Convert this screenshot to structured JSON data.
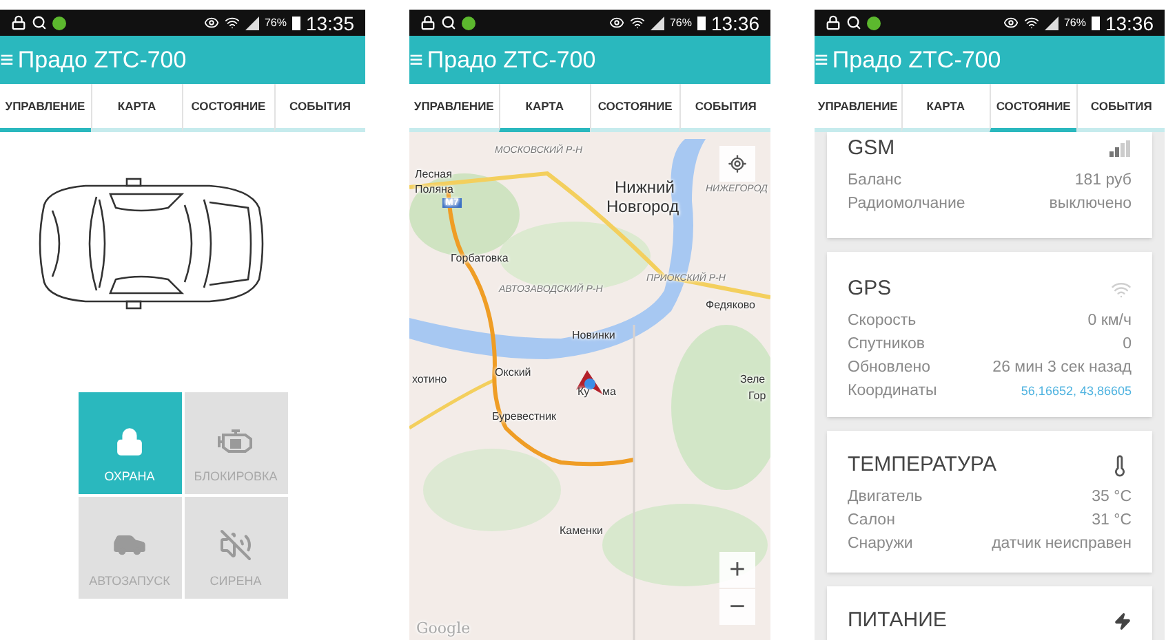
{
  "screens": [
    {
      "status_bar": {
        "battery": "76%",
        "time": "13:35"
      },
      "app_bar": {
        "menu": "≡",
        "title": "Прадо ZTC-700"
      },
      "tabs": [
        {
          "label": "УПРАВЛЕНИЕ",
          "selected": true
        },
        {
          "label": "КАРТА",
          "selected": false
        },
        {
          "label": "СОСТОЯНИЕ",
          "selected": false
        },
        {
          "label": "СОБЫТИЯ",
          "selected": false
        }
      ],
      "content": {
        "kind": "control",
        "tiles": [
          {
            "kind": "lock",
            "label": "ОХРАНА",
            "active": true
          },
          {
            "kind": "engine",
            "label": "БЛОКИРОВКА",
            "active": false
          },
          {
            "kind": "car",
            "label": "АВТОЗАПУСК",
            "active": false
          },
          {
            "kind": "siren",
            "label": "СИРЕНА",
            "active": false
          }
        ]
      }
    },
    {
      "status_bar": {
        "battery": "76%",
        "time": "13:36"
      },
      "app_bar": {
        "menu": "≡",
        "title": "Прадо ZTC-700"
      },
      "tabs": [
        {
          "label": "УПРАВЛЕНИЕ",
          "selected": false
        },
        {
          "label": "КАРТА",
          "selected": true
        },
        {
          "label": "СОСТОЯНИЕ",
          "selected": false
        },
        {
          "label": "СОБЫТИЯ",
          "selected": false
        }
      ],
      "content": {
        "kind": "map",
        "zoom_in": "+",
        "zoom_out": "−",
        "labels": [
          {
            "kind": "district",
            "text": "МОСКОВСКИЙ Р-Н"
          },
          {
            "kind": "town",
            "text": "Лесная"
          },
          {
            "kind": "town",
            "text": "Поляна"
          },
          {
            "kind": "badge",
            "text": "M7"
          },
          {
            "kind": "city",
            "text": "Нижний"
          },
          {
            "kind": "city",
            "text": "Новгород"
          },
          {
            "kind": "district",
            "text": "НИЖЕГОРОД"
          },
          {
            "kind": "town",
            "text": "Горбатовка"
          },
          {
            "kind": "district",
            "text": "АВТОЗАВОДСКИЙ Р-Н"
          },
          {
            "kind": "district",
            "text": "ПРИОКСКИЙ Р-Н"
          },
          {
            "kind": "town",
            "text": "Федяково"
          },
          {
            "kind": "town",
            "text": "Новинки"
          },
          {
            "kind": "town",
            "text": "хотино"
          },
          {
            "kind": "town",
            "text": "Окский"
          },
          {
            "kind": "town",
            "text": "Ку"
          },
          {
            "kind": "town",
            "text": "ма"
          },
          {
            "kind": "town",
            "text": "Зеле"
          },
          {
            "kind": "town",
            "text": "Гор"
          },
          {
            "kind": "town",
            "text": "Буревестник"
          },
          {
            "kind": "town",
            "text": "Каменки"
          },
          {
            "kind": "logo",
            "text": "Google"
          }
        ]
      }
    },
    {
      "status_bar": {
        "battery": "76%",
        "time": "13:36"
      },
      "app_bar": {
        "menu": "≡",
        "title": "Прадо ZTC-700"
      },
      "tabs": [
        {
          "label": "УПРАВЛЕНИЕ",
          "selected": false
        },
        {
          "label": "КАРТА",
          "selected": false
        },
        {
          "label": "СОСТОЯНИЕ",
          "selected": true
        },
        {
          "label": "СОБЫТИЯ",
          "selected": false
        }
      ],
      "content": {
        "kind": "status",
        "cards": [
          {
            "kind": "gsm",
            "title": "GSM",
            "rows": [
              {
                "label": "Баланс",
                "value": "181 руб",
                "link": false
              },
              {
                "label": "Радиомолчание",
                "value": "выключено",
                "link": false
              }
            ]
          },
          {
            "kind": "gps",
            "title": "GPS",
            "rows": [
              {
                "label": "Скорость",
                "value": "0 км/ч",
                "link": false
              },
              {
                "label": "Спутников",
                "value": "0",
                "link": false
              },
              {
                "label": "Обновлено",
                "value": "26 мин 3 сек назад",
                "link": false
              },
              {
                "label": "Координаты",
                "value": "56,16652, 43,86605",
                "link": true
              }
            ]
          },
          {
            "kind": "temperature",
            "title": "ТЕМПЕРАТУРА",
            "rows": [
              {
                "label": "Двигатель",
                "value": "35 °C",
                "link": false
              },
              {
                "label": "Салон",
                "value": "31 °C",
                "link": false
              },
              {
                "label": "Снаружи",
                "value": "датчик неисправен",
                "link": false
              }
            ]
          },
          {
            "kind": "power",
            "title": "ПИТАНИЕ"
          }
        ]
      }
    }
  ]
}
